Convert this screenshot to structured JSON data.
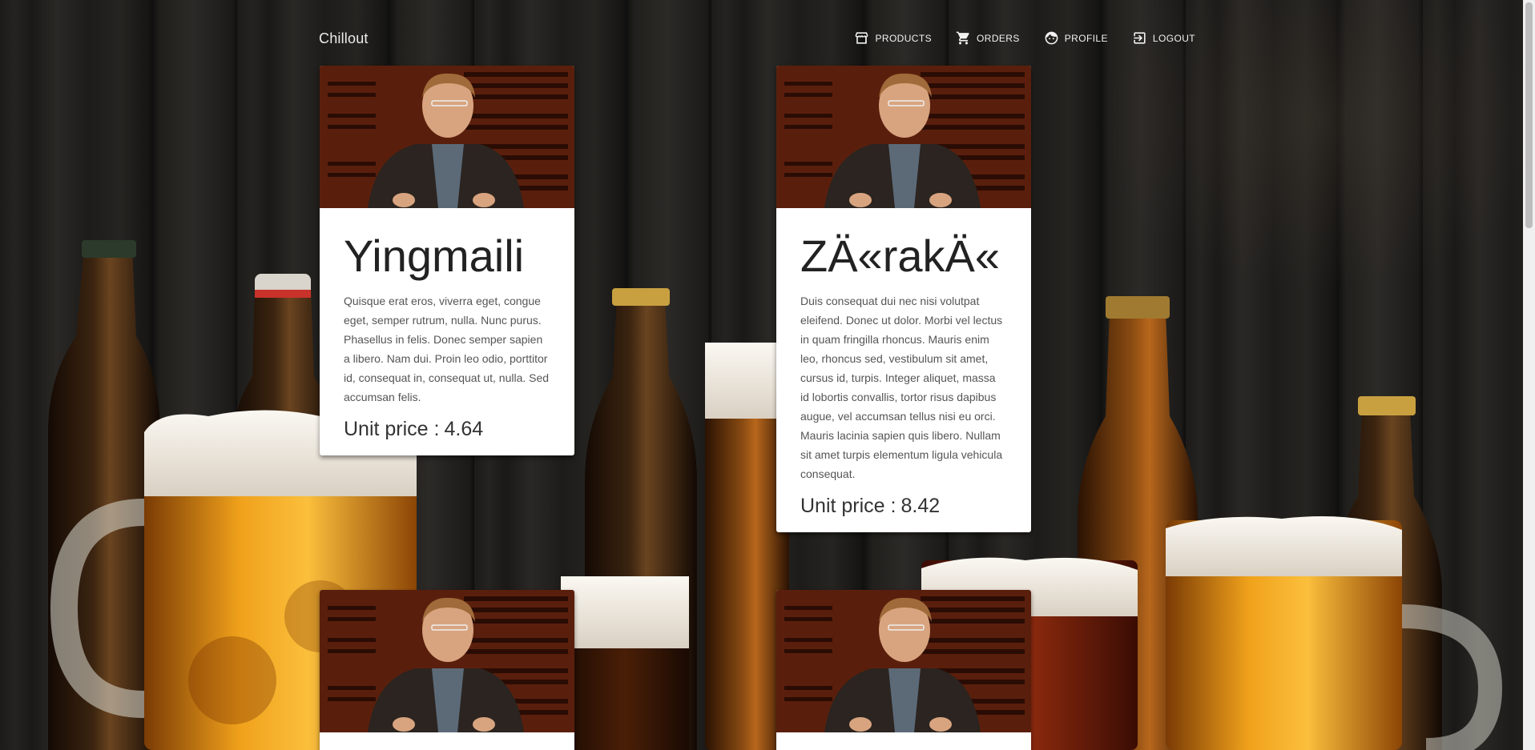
{
  "navbar": {
    "brand": "Chillout",
    "items": [
      {
        "label": "PRODUCTS",
        "icon": "store-icon"
      },
      {
        "label": "ORDERS",
        "icon": "cart-icon"
      },
      {
        "label": "PROFILE",
        "icon": "face-icon"
      },
      {
        "label": "LOGOUT",
        "icon": "logout-icon"
      }
    ]
  },
  "products": [
    {
      "title": "Yingmaili",
      "description": "Quisque erat eros, viverra eget, congue eget, semper rutrum, nulla. Nunc purus. Phasellus in felis. Donec semper sapien a libero. Nam dui. Proin leo odio, porttitor id, consequat in, consequat ut, nulla. Sed accumsan felis.",
      "price_label": "Unit price :",
      "price": "4.64"
    },
    {
      "title": "ZÄ«rakÄ«",
      "description": "Duis consequat dui nec nisi volutpat eleifend. Donec ut dolor. Morbi vel lectus in quam fringilla rhoncus. Mauris enim leo, rhoncus sed, vestibulum sit amet, cursus id, turpis. Integer aliquet, massa id lobortis convallis, tortor risus dapibus augue, vel accumsan tellus nisi eu orci. Mauris lacinia sapien quis libero. Nullam sit amet turpis elementum ligula vehicula consequat.",
      "price_label": "Unit price :",
      "price": "8.42"
    }
  ],
  "colors": {
    "background": "#1e1d1b",
    "card": "#ffffff",
    "nav_text": "#f2f2f2",
    "beer_amber": "#e08a12",
    "foam": "#f1ede6"
  }
}
